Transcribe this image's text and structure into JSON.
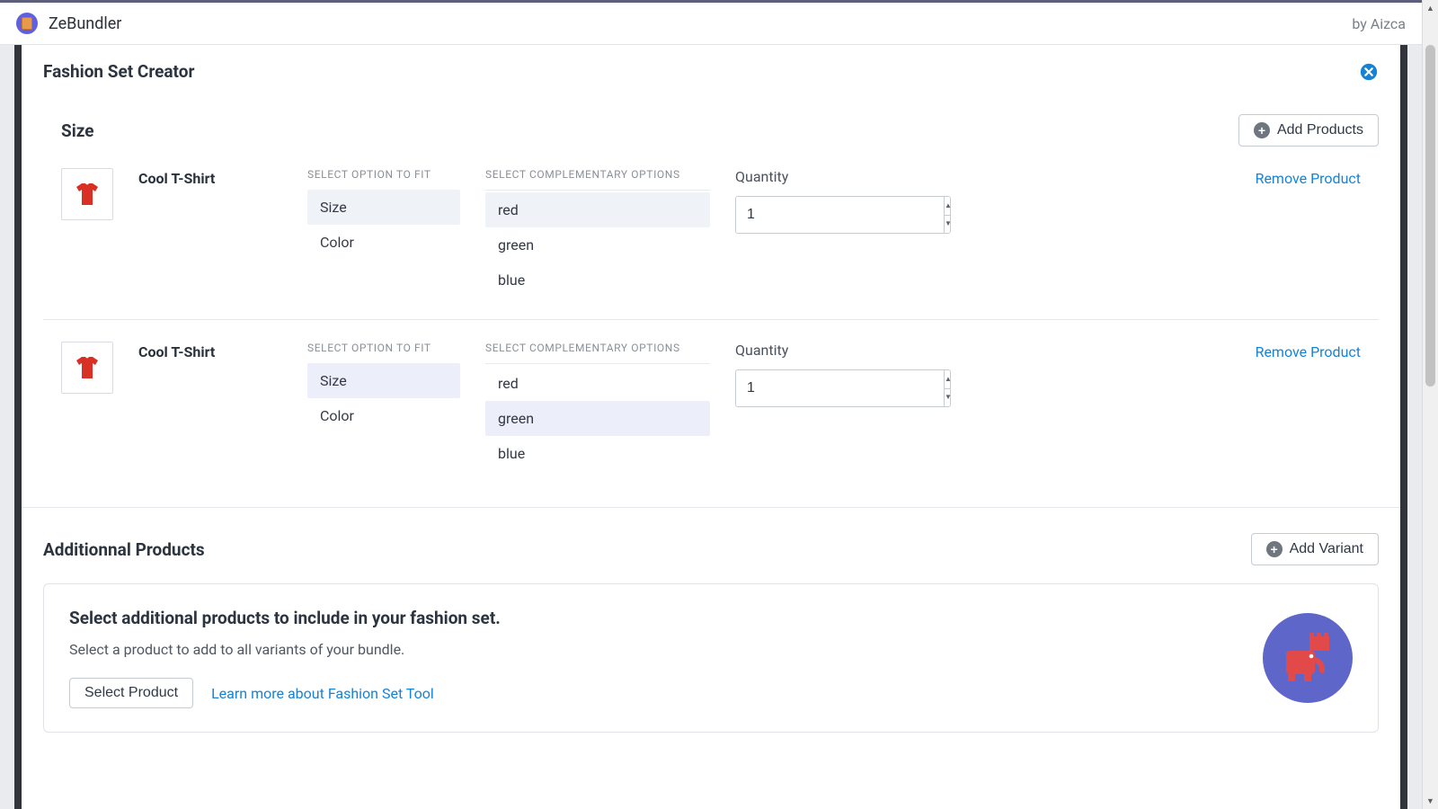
{
  "app": {
    "name": "ZeBundler",
    "by_line": "by Aizca"
  },
  "modal": {
    "title": "Fashion Set Creator"
  },
  "size_section": {
    "title": "Size",
    "add_products_label": "Add Products",
    "fit_label": "SELECT OPTION TO FIT",
    "comp_label": "SELECT COMPLEMENTARY OPTIONS",
    "quantity_label": "Quantity",
    "remove_label": "Remove Product",
    "products": [
      {
        "name": "Cool T-Shirt",
        "fit_options": {
          "size": "Size",
          "color": "Color"
        },
        "comp_options": {
          "red": "red",
          "green": "green",
          "blue": "blue"
        },
        "fit_selected": "size",
        "comp_selected": "red",
        "quantity": "1"
      },
      {
        "name": "Cool T-Shirt",
        "fit_options": {
          "size": "Size",
          "color": "Color"
        },
        "comp_options": {
          "red": "red",
          "green": "green",
          "blue": "blue"
        },
        "fit_selected": "size",
        "comp_selected": "green",
        "quantity": "1"
      }
    ]
  },
  "additional": {
    "title": "Additionnal Products",
    "add_variant_label": "Add Variant",
    "card_title": "Select additional products to include in your fashion set.",
    "card_body": "Select a product to add to all variants of your bundle.",
    "select_product_label": "Select Product",
    "learn_more_label": "Learn more about Fashion Set Tool"
  }
}
